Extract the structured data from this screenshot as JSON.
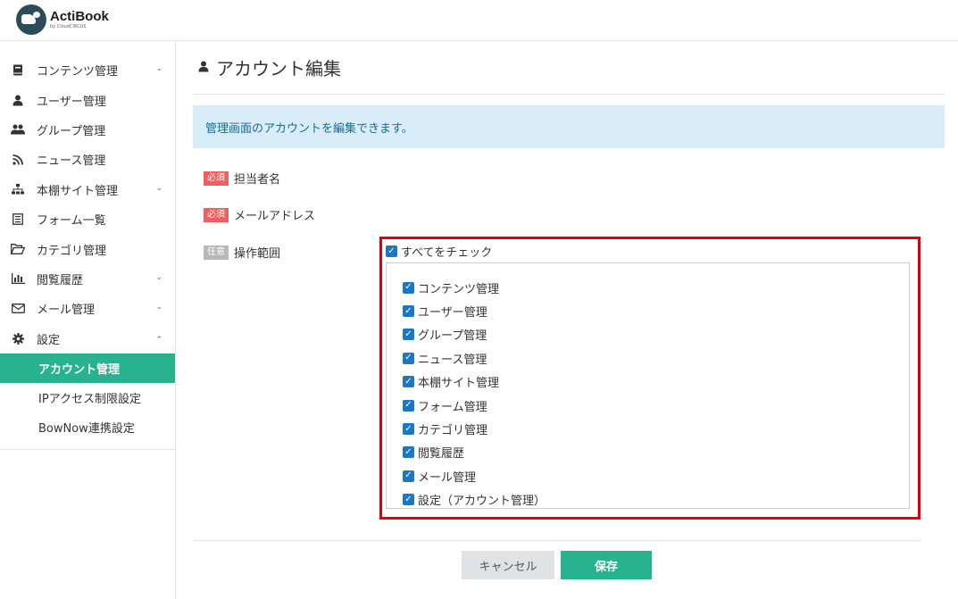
{
  "app": {
    "name": "ActiBook",
    "sub": "by CloudCIRCUS"
  },
  "sidebar": {
    "items": [
      {
        "label": "コンテンツ管理",
        "icon": "book-icon",
        "expandable": true
      },
      {
        "label": "ユーザー管理",
        "icon": "user-icon",
        "expandable": false
      },
      {
        "label": "グループ管理",
        "icon": "users-icon",
        "expandable": false
      },
      {
        "label": "ニュース管理",
        "icon": "rss-icon",
        "expandable": false
      },
      {
        "label": "本棚サイト管理",
        "icon": "sitemap-icon",
        "expandable": true
      },
      {
        "label": "フォーム一覧",
        "icon": "form-icon",
        "expandable": false
      },
      {
        "label": "カテゴリ管理",
        "icon": "folder-open-icon",
        "expandable": false
      },
      {
        "label": "閲覧履歴",
        "icon": "bar-chart-icon",
        "expandable": true
      },
      {
        "label": "メール管理",
        "icon": "envelope-icon",
        "expandable": true
      },
      {
        "label": "設定",
        "icon": "gear-icon",
        "expandable": true,
        "expanded": true
      }
    ],
    "sub_items": [
      {
        "label": "アカウント管理",
        "active": true
      },
      {
        "label": "IPアクセス制限設定",
        "active": false
      },
      {
        "label": "BowNow連携設定",
        "active": false
      }
    ]
  },
  "main": {
    "title": "アカウント編集",
    "info": "管理画面のアカウントを編集できます。",
    "fields": [
      {
        "badge": "必須",
        "label": "担当者名"
      },
      {
        "badge": "必須",
        "label": "メールアドレス"
      },
      {
        "badge": "任意",
        "label": "操作範囲"
      }
    ],
    "check_all_label": "すべてをチェック",
    "permissions": [
      "コンテンツ管理",
      "ユーザー管理",
      "グループ管理",
      "ニュース管理",
      "本棚サイト管理",
      "フォーム管理",
      "カテゴリ管理",
      "閲覧履歴",
      "メール管理",
      "設定（アカウント管理）"
    ]
  },
  "buttons": {
    "cancel": "キャンセル",
    "save": "保存"
  },
  "colors": {
    "accent": "#27b38f",
    "info_bg": "#d9edf9",
    "required": "#ef5f5f",
    "optional": "#b8b8b8",
    "checkbox": "#1b78c6",
    "highlight": "#e0000b"
  }
}
